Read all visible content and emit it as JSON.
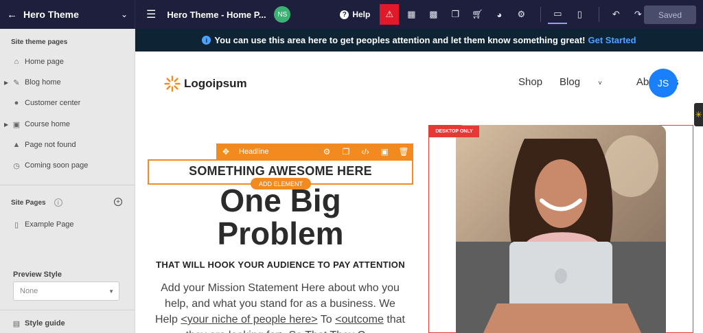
{
  "topbar": {
    "site_title": "Hero Theme",
    "page_title": "Hero Theme - Home P...",
    "user_initials": "NS",
    "help_label": "Help",
    "saved_label": "Saved"
  },
  "sidebar": {
    "theme_pages_heading": "Site theme pages",
    "theme_pages": [
      {
        "label": "Home page",
        "icon": "home-icon",
        "expandable": false
      },
      {
        "label": "Blog home",
        "icon": "blog-icon",
        "expandable": true
      },
      {
        "label": "Customer center",
        "icon": "user-icon",
        "expandable": false
      },
      {
        "label": "Course home",
        "icon": "course-icon",
        "expandable": true
      },
      {
        "label": "Page not found",
        "icon": "warning-icon",
        "expandable": false
      },
      {
        "label": "Coming soon page",
        "icon": "clock-icon",
        "expandable": false
      }
    ],
    "site_pages_heading": "Site Pages",
    "site_pages": [
      {
        "label": "Example Page",
        "icon": "page-icon"
      }
    ],
    "preview_style_label": "Preview Style",
    "preview_style_value": "None",
    "style_guide_label": "Style guide"
  },
  "canvas": {
    "announcement_text": "You can use this area here to get peoples attention and let them know something great!",
    "announcement_link": "Get Started",
    "logo_text": "Logoipsum",
    "nav": [
      "Shop",
      "Blog",
      "About Us"
    ],
    "nav_avatar": "JS",
    "headline_toolbar_label": "Headline",
    "add_element_label": "ADD ELEMENT",
    "headline": "SOMETHING AWESOME HERE",
    "big_title_line1": "One Big",
    "big_title_line2": "Problem",
    "subtitle": "THAT WILL HOOK YOUR AUDIENCE TO PAY ATTENTION",
    "mission_1": "Add your Mission Statement Here about who you help, and what you stand for as a business. We Help",
    "mission_link1": "<your niche of people here>",
    "mission_2": "To",
    "mission_link2": "<outcome",
    "mission_3": "that they are looking for> So That They C...",
    "desktop_only_badge": "DESKTOP ONLY"
  },
  "colors": {
    "topbar_bg": "#1e1f3d",
    "accent_orange": "#f28a1f",
    "alert_red": "#e2192a",
    "link_blue": "#4ba3ff",
    "avatar_blue": "#1a7ffb"
  }
}
